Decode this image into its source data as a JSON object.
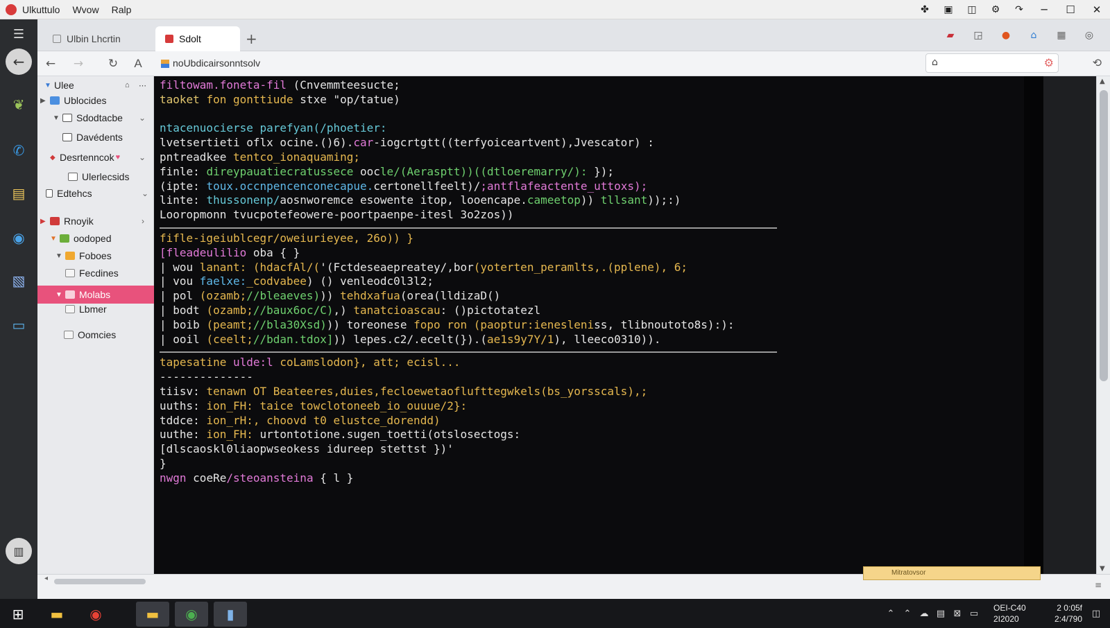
{
  "titlebar": {
    "menu": [
      "Ulkuttulo",
      "Wvow",
      "Ralp"
    ]
  },
  "tabs": [
    {
      "label": "Ulbin Lhcrtin"
    },
    {
      "label": "Sdolt"
    }
  ],
  "addressbar": {
    "url": "noUbdicairsonntsolv"
  },
  "sidebar": {
    "items": [
      {
        "label": "Ulee"
      },
      {
        "label": "Ublocides"
      },
      {
        "label": "Sdodtacbe"
      },
      {
        "label": "Davédents"
      },
      {
        "label": "Desrtenncok"
      },
      {
        "label": "Ulerlecsids"
      },
      {
        "label": "Edtehcs"
      },
      {
        "label": "Rnoyik"
      },
      {
        "label": "oodoped"
      },
      {
        "label": "Foboes"
      },
      {
        "label": "Fecdines"
      },
      {
        "label": "Molabs"
      },
      {
        "label": "Lbmer"
      },
      {
        "label": "Oomcies"
      }
    ]
  },
  "editor": {
    "lines": [
      [
        {
          "t": "filtowam.foneta-fil ",
          "c": "#e27ad8"
        },
        {
          "t": "(Cnvemmteesucte;",
          "c": "#e6e6e6"
        }
      ],
      [
        {
          "t": "taoket ",
          "c": "#e2c66e"
        },
        {
          "t": "fon gonttiude ",
          "c": "#e6b84f"
        },
        {
          "t": "stxe \"op/tatue) ",
          "c": "#e6e6e6"
        }
      ],
      [],
      [
        {
          "t": "ntacenuocierse parefyan(/phoetier:",
          "c": "#66c9d8"
        }
      ],
      [
        {
          "t": "lvetsertieti oflx ocine.()6).",
          "c": "#e6e6e6"
        },
        {
          "t": "car",
          "c": "#e27ad8"
        },
        {
          "t": "-iogcrtgtt((terfyoiceartvent),Jvescator) :",
          "c": "#e6e6e6"
        }
      ],
      [
        {
          "t": "pntreadkee ",
          "c": "#e6e6e6"
        },
        {
          "t": "tentco_ionaquaming;",
          "c": "#e6b84f"
        }
      ],
      [
        {
          "t": "finle: ",
          "c": "#e6e6e6"
        },
        {
          "t": "direypauatiecratussece ",
          "c": "#6fd16f"
        },
        {
          "t": "ooc",
          "c": "#e6e6e6"
        },
        {
          "t": "le/(Aerasptt))((dtloeremarry/):",
          "c": "#6fd16f"
        },
        {
          "t": " });",
          "c": "#e6e6e6"
        }
      ],
      [
        {
          "t": "(ipte: ",
          "c": "#e6e6e6"
        },
        {
          "t": "toux.occnpencenconecapue.",
          "c": "#5fb8e8"
        },
        {
          "t": "certonell",
          "c": "#e6e6e6"
        },
        {
          "t": "feelt)/",
          "c": "#e6e6e6"
        },
        {
          "t": ";antflafeactente_uttoxs);",
          "c": "#e27ad8"
        }
      ],
      [
        {
          "t": "linte: ",
          "c": "#e6e6e6"
        },
        {
          "t": "thussonenp/",
          "c": "#66c9d8"
        },
        {
          "t": "aosnworemce esowente itop, ",
          "c": "#e6e6e6"
        },
        {
          "t": "looencape.",
          "c": "#e6e6e6"
        },
        {
          "t": "cameetop",
          "c": "#6fd16f"
        },
        {
          "t": ")) ",
          "c": "#e6e6e6"
        },
        {
          "t": "tllsant",
          "c": "#6fd16f"
        },
        {
          "t": "));:)",
          "c": "#e6e6e6"
        }
      ],
      [
        {
          "t": "Looropmonn tvucpotefeowere-poortpaenpe-itesl 3o2zos))",
          "c": "#e6e6e6"
        }
      ],
      [
        "SEP"
      ],
      [
        {
          "t": "fifle-igeiublcegr/oweiurieyee, 26o)) }",
          "c": "#e6b84f"
        }
      ],
      [
        {
          "t": "[fleadeulilio ",
          "c": "#e27ad8"
        },
        {
          "t": "oba { }",
          "c": "#e6e6e6"
        }
      ],
      [
        {
          "t": "| wou ",
          "c": "#e6e6e6"
        },
        {
          "t": "lanant: ",
          "c": "#e6b84f"
        },
        {
          "t": "(hdacfAl/(",
          "c": "#e6b84f"
        },
        {
          "t": "'(Fctdeseaepreatey/,",
          "c": "#e6e6e6"
        },
        {
          "t": "bor",
          "c": "#e6e6e6"
        },
        {
          "t": "(yoterten_peramlts,.(pplene), 6;",
          "c": "#e6b84f"
        }
      ],
      [
        {
          "t": "| vou ",
          "c": "#e6e6e6"
        },
        {
          "t": "faelxe:",
          "c": "#5fb8e8"
        },
        {
          "t": "_codvabee",
          "c": "#e6b84f"
        },
        {
          "t": ") () venleodc0l3l2;",
          "c": "#e6e6e6"
        }
      ],
      [
        {
          "t": "| pol ",
          "c": "#e6e6e6"
        },
        {
          "t": "(ozamb;",
          "c": "#e6b84f"
        },
        {
          "t": "//bleaeves)",
          "c": "#6fd16f"
        },
        {
          "t": ")) ",
          "c": "#e6e6e6"
        },
        {
          "t": "tehdxafua",
          "c": "#e6b84f"
        },
        {
          "t": "(orea(lldizaD()",
          "c": "#e6e6e6"
        }
      ],
      [
        {
          "t": "| bodt ",
          "c": "#e6e6e6"
        },
        {
          "t": "(ozamb;",
          "c": "#e6b84f"
        },
        {
          "t": "//baux6oc/C)",
          "c": "#6fd16f"
        },
        {
          "t": ",) ",
          "c": "#e6e6e6"
        },
        {
          "t": "tanatcioascau",
          "c": "#e6b84f"
        },
        {
          "t": ": ()pictotatezl",
          "c": "#e6e6e6"
        }
      ],
      [
        {
          "t": "| boib ",
          "c": "#e6e6e6"
        },
        {
          "t": "(peamt;",
          "c": "#e6b84f"
        },
        {
          "t": "//bla30Xsd)",
          "c": "#6fd16f"
        },
        {
          "t": ")) ",
          "c": "#e6e6e6"
        },
        {
          "t": "toreonese ",
          "c": "#e6e6e6"
        },
        {
          "t": "fopo ron ",
          "c": "#e6b84f"
        },
        {
          "t": "(paoptur:ienesleni",
          "c": "#e6b84f"
        },
        {
          "t": "ss, tlibnoutoto8s):):",
          "c": "#e6e6e6"
        }
      ],
      [
        {
          "t": "| ooil ",
          "c": "#e6e6e6"
        },
        {
          "t": "(ceelt;",
          "c": "#e6b84f"
        },
        {
          "t": "//bdan.tdox]",
          "c": "#6fd16f"
        },
        {
          "t": ")) ",
          "c": "#e6e6e6"
        },
        {
          "t": "lepes.c2/.ecelt",
          "c": "#e6e6e6"
        },
        {
          "t": "(}).(",
          "c": "#e6e6e6"
        },
        {
          "t": "ae1s9y7Y/1",
          "c": "#e6b84f"
        },
        {
          "t": "), lleeco0310)).",
          "c": "#e6e6e6"
        }
      ],
      [
        "SEP"
      ],
      [
        {
          "t": "tapesatine ",
          "c": "#e6b84f"
        },
        {
          "t": "ulde:l ",
          "c": "#e27ad8"
        },
        {
          "t": "coLamslodon}, att; ecisl...",
          "c": "#e6b84f"
        }
      ],
      [
        {
          "t": "--------------",
          "c": "#e6e6e6"
        }
      ],
      [
        {
          "t": "tiisv: ",
          "c": "#e6e6e6"
        },
        {
          "t": "tenawn OT Beateeres,duies,feclo",
          "c": "#e6b84f"
        },
        {
          "t": "ewetaofluf",
          "c": "#e6b84f"
        },
        {
          "t": "ttegwkels(bs_yorsscals),;",
          "c": "#e6b84f"
        }
      ],
      [
        {
          "t": "uuths: ",
          "c": "#e6e6e6"
        },
        {
          "t": "ion_FH: taice towclotoneeb_io_ouuue/2}:",
          "c": "#e6b84f"
        }
      ],
      [
        {
          "t": "tddce: ",
          "c": "#e6e6e6"
        },
        {
          "t": "ion_rH:, choovd t0 elustce_dorendd)",
          "c": "#e6b84f"
        }
      ],
      [
        {
          "t": "uuthe: ",
          "c": "#e6e6e6"
        },
        {
          "t": "ion_FH: ",
          "c": "#e6b84f"
        },
        {
          "t": "urtontotione.sugen_toetti(otslosectogs:",
          "c": "#e6e6e6"
        }
      ],
      [
        {
          "t": "[dlscaoskl0liaopwseokess idureep stettst })'",
          "c": "#e6e6e6"
        }
      ],
      [
        {
          "t": "}",
          "c": "#e6e6e6"
        }
      ],
      [
        {
          "t": "nwgn ",
          "c": "#e27ad8"
        },
        {
          "t": "coeRe",
          "c": "#e6e6e6"
        },
        {
          "t": "/steoansteina",
          "c": "#e27ad8"
        },
        {
          "t": " { l }",
          "c": "#e6e6e6"
        }
      ]
    ]
  },
  "notification": {
    "text": "Mitratovsor"
  },
  "taskbar": {
    "clock": {
      "row1_left": "OEI-C40",
      "row1_right": "2 0:05f",
      "row2_left": "2I2020",
      "row2_right": "2:4/790"
    }
  },
  "colors": {
    "accent_selected": "#e8527c",
    "editor_bg": "#0b0b0d"
  }
}
